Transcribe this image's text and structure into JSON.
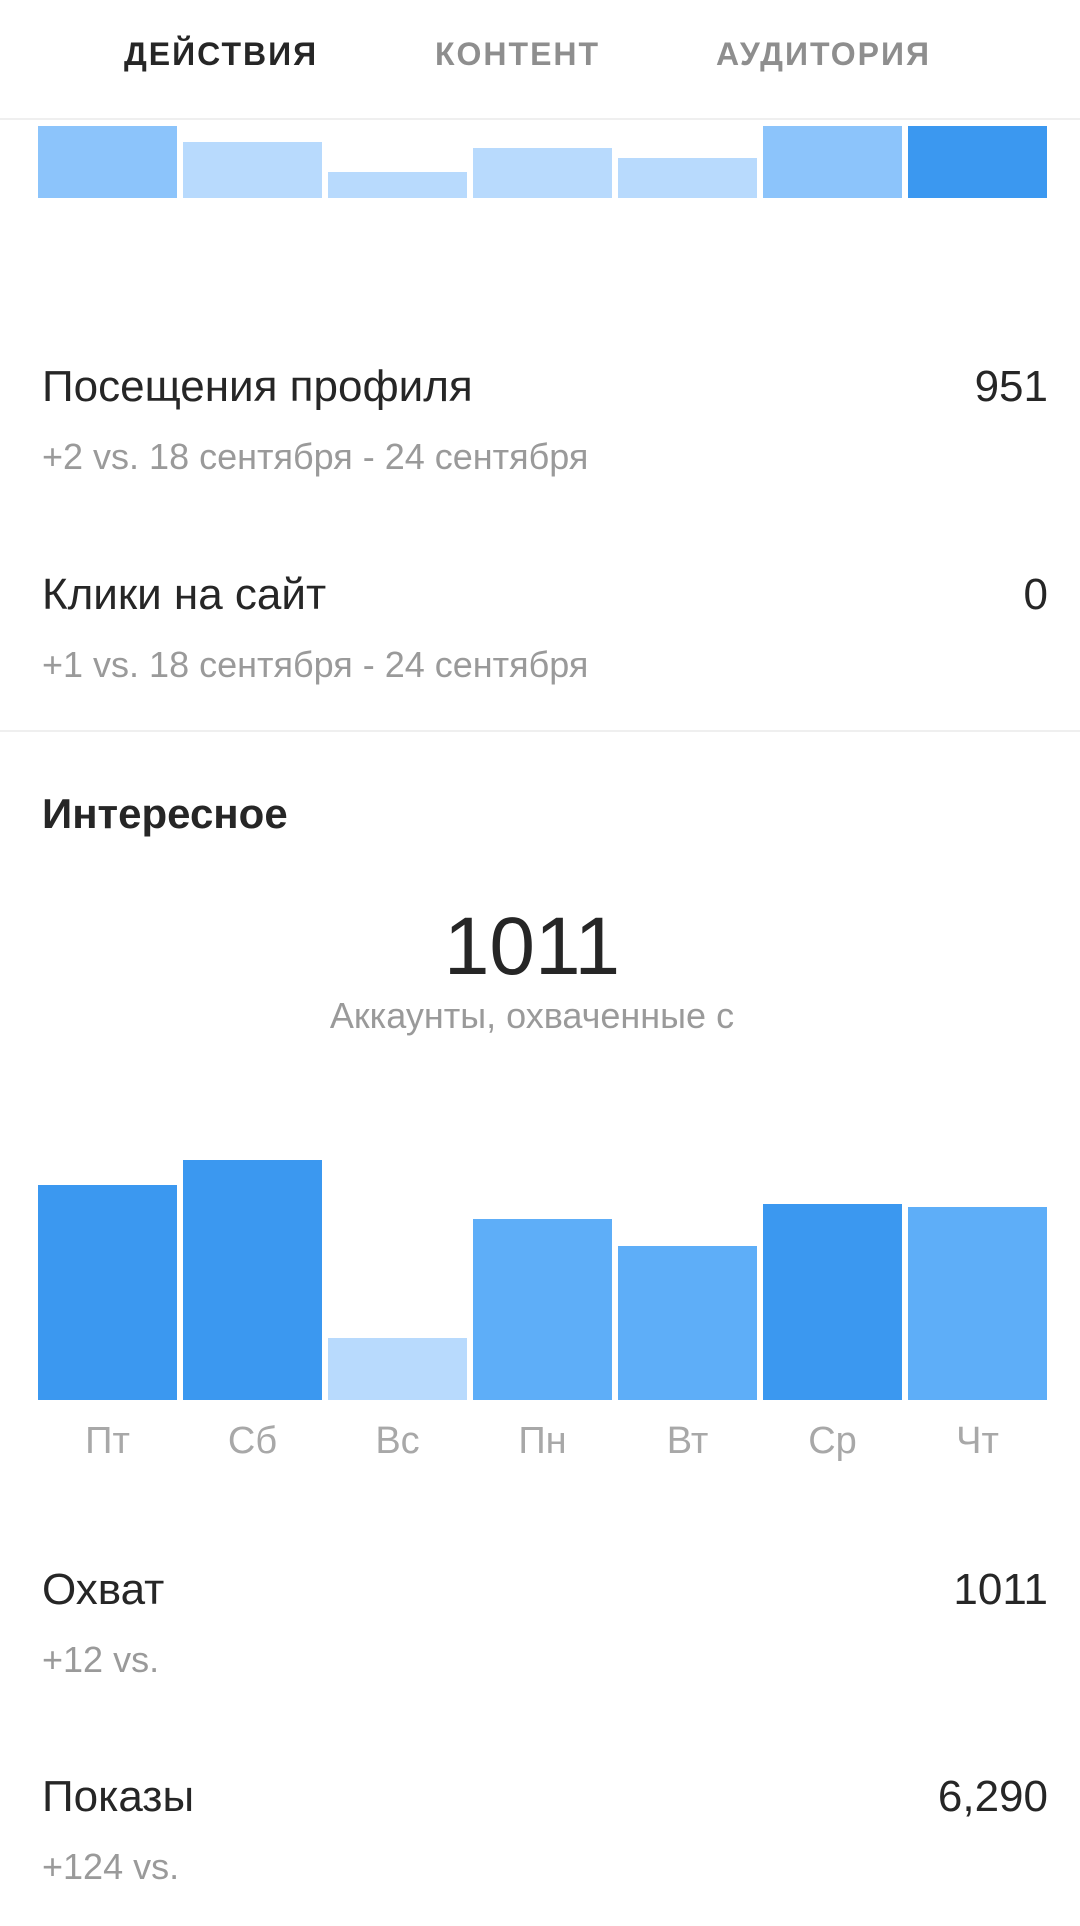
{
  "tabs": [
    {
      "label": "ДЕЙСТВИЯ",
      "active": true
    },
    {
      "label": "КОНТЕНТ",
      "active": false
    },
    {
      "label": "АУДИТОРИЯ",
      "active": false
    }
  ],
  "top_chart": {
    "bar_colors": [
      "#8cc4fb",
      "#b8dafd",
      "#b8dafd",
      "#b8dafd",
      "#b8dafd",
      "#8cc4fb",
      "#3b98f0"
    ]
  },
  "metrics_top": [
    {
      "label": "Посещения профиля",
      "value": "951",
      "sub": "+2 vs. 18 сентября - 24 сентября"
    },
    {
      "label": "Клики на сайт",
      "value": "0",
      "sub": "+1 vs. 18 сентября - 24 сентября"
    }
  ],
  "section": {
    "title": "Интересное",
    "big_number": "1011",
    "caption": "Аккаунты, охваченные с"
  },
  "chart_data": {
    "type": "bar",
    "categories": [
      "Пт",
      "Сб",
      "Вс",
      "Пн",
      "Вт",
      "Ср",
      "Чт"
    ],
    "values": [
      190,
      212,
      55,
      160,
      136,
      173,
      171
    ],
    "colors": [
      "#3b98f0",
      "#3b98f0",
      "#b8dafd",
      "#5eaef8",
      "#5eaef8",
      "#3b98f0",
      "#5eaef8"
    ]
  },
  "metrics_bottom": [
    {
      "label": "Охват",
      "value": "1011",
      "sub": "+12 vs."
    },
    {
      "label": "Показы",
      "value": "6,290",
      "sub": "+124 vs."
    }
  ]
}
